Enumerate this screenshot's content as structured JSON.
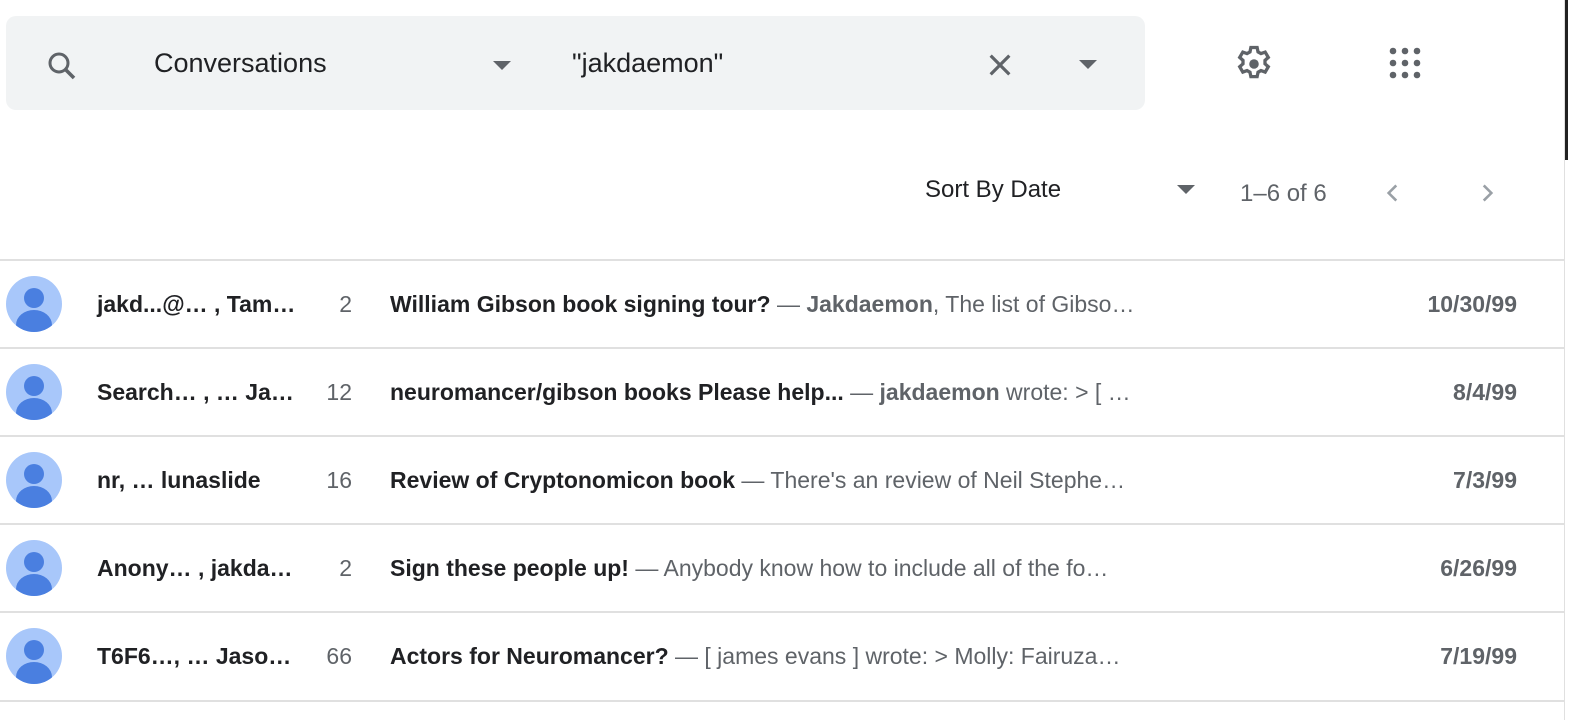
{
  "search": {
    "scope": "Conversations",
    "query": "\"jakdaemon\""
  },
  "toolbar": {
    "sort_label": "Sort By Date",
    "pagination": "1–6 of 6"
  },
  "colors": {
    "avatar_bg": "#a8c7fa",
    "avatar_fg": "#4a7fe0",
    "search_bg": "#f1f3f4"
  },
  "conversations": [
    {
      "sender": "jakd...@… , Tam…",
      "count": "2",
      "subject": "William Gibson book signing tour?",
      "sep": " — ",
      "snippet_bold": "Jakdaemon",
      "snippet": ", The list of Gibso…",
      "date": "10/30/99"
    },
    {
      "sender": "Search… , … Ja…",
      "count": "12",
      "subject": "neuromancer/gibson books Please help...",
      "sep": " — ",
      "snippet_bold": "jakdaemon",
      "snippet": " wrote: > [ …",
      "date": "8/4/99"
    },
    {
      "sender": "nr, … lunaslide",
      "count": "16",
      "subject": "Review of Cryptonomicon book",
      "sep": " — ",
      "snippet_bold": "",
      "snippet": "There's an review of Neil Stephe…",
      "date": "7/3/99"
    },
    {
      "sender": "Anony… , jakda…",
      "count": "2",
      "subject": "Sign these people up!",
      "sep": " — ",
      "snippet_bold": "",
      "snippet": "Anybody know how to include all of the fo…",
      "date": "6/26/99"
    },
    {
      "sender": "T6F6…, … Jaso…",
      "count": "66",
      "subject": "Actors for Neuromancer?",
      "sep": " — ",
      "snippet_bold": "",
      "snippet": "[ james evans ] wrote: > Molly: Fairuza…",
      "date": "7/19/99"
    }
  ]
}
